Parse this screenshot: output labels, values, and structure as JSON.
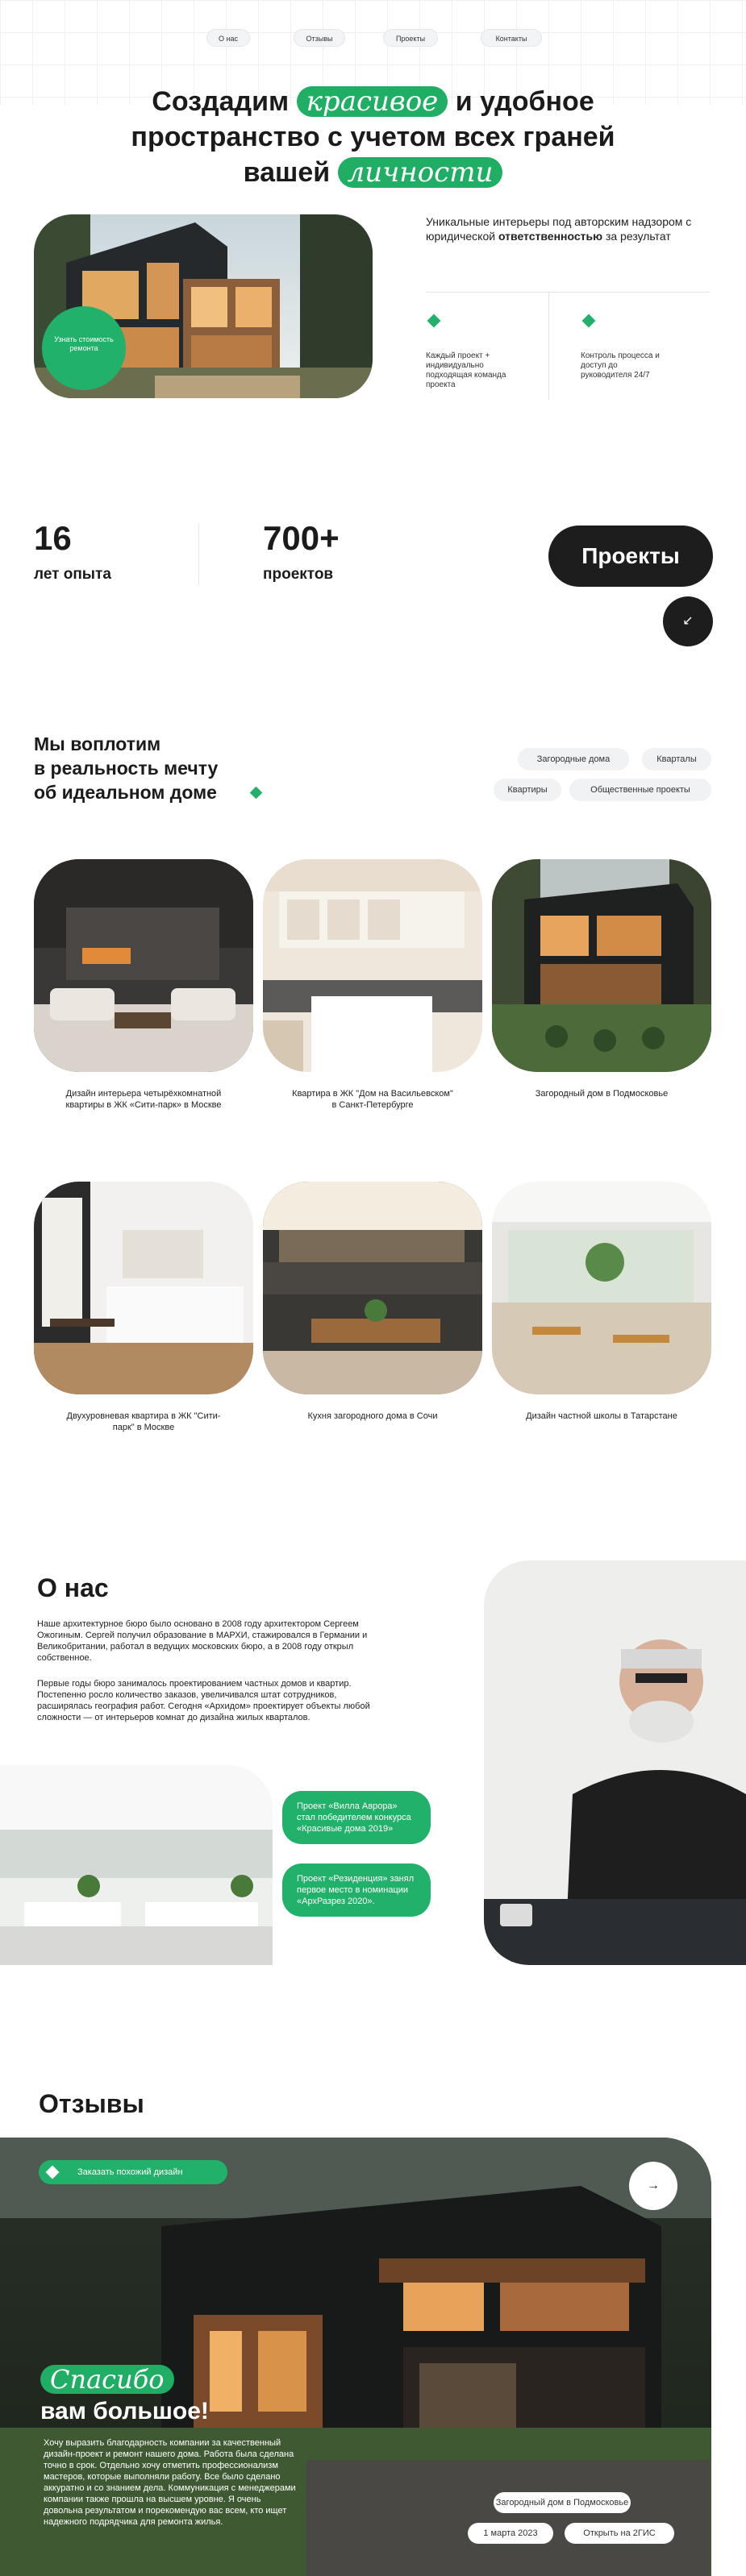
{
  "nav": {
    "items": [
      "О нас",
      "Отзывы",
      "Проекты",
      "Контакты"
    ]
  },
  "hero": {
    "line1_a": "Создадим",
    "line1_hl": "красивое",
    "line1_b": "и удобное",
    "line2": "пространство с учетом всех граней",
    "line3_a": "вашей",
    "line3_hl": "личности",
    "cta_badge": "Узнать стоимость ремонта",
    "tagline_a": "Уникальные интерьеры под авторским надзором с юридической",
    "tagline_bold": "ответственностью",
    "tagline_b": "за результат",
    "feature1": "Каждый проект + индивидуально подходящая команда проекта",
    "feature2": "Контроль процесса и доступ до руководителя 24/7"
  },
  "stats": {
    "years_num": "16",
    "years_label": "лет опыта",
    "projects_num": "700+",
    "projects_label": "проектов",
    "projects_button": "Проекты",
    "arrow": "↙"
  },
  "portfolio": {
    "title_l1": "Мы воплотим",
    "title_l2": "в реальность мечту",
    "title_l3": "об идеальном доме",
    "filters": [
      "Загородные дома",
      "Кварталы",
      "Квартиры",
      "Общественные проекты"
    ],
    "cards": [
      "Дизайн интерьера четырёхкомнатной квартиры в ЖК «Сити-парк» в Москве",
      "Квартира в ЖК \"Дом на Васильевском\" в Санкт-Петербурге",
      "Загородный дом в Подмосковье",
      "Двухуровневая квартира в ЖК \"Сити-парк\" в Москве",
      "Кухня загородного дома в Сочи",
      "Дизайн частной школы в Татарстане"
    ]
  },
  "about": {
    "title": "О нас",
    "p1": "Наше архитектурное бюро было основано в 2008 году архитектором Сергеем Ожогиным. Сергей получил образование в МАРХИ, стажировался в Германии и Великобритании, работал в ведущих московских бюро, а в 2008 году открыл собственное.",
    "p2": "Первые годы бюро занималось проектированием частных домов и квартир. Постепенно росло количество заказов, увеличивался штат сотрудников, расширялась география работ. Сегодня «Архидом» проектирует объекты любой сложности — от интерьеров комнат до дизайна жилых кварталов.",
    "award1": "Проект «Вилла Аврора» стал победителем конкурса «Красивые дома 2019»",
    "award2": "Проект «Резиденция» занял первое место в номинации «АрхРазрез 2020»."
  },
  "reviews": {
    "title": "Отзывы",
    "order_btn": "Заказать похожий дизайн",
    "thanks_hl": "Спасибо",
    "thanks_rest": "вам большое!",
    "text": "Хочу выразить благодарность компании за качественный дизайн-проект и ремонт нашего дома. Работа была сделана точно в срок. Отдельно хочу отметить профессионализм мастеров, которые выполняли работу. Все было сделано аккуратно и со знанием дела. Коммуникация с менеджерами компании также прошла на высшем уровне. Я очень довольна результатом и порекомендую вас всем, кто ищет надежного подрядчика для ремонта жилья.",
    "project_tag": "Загородный дом в Подмосковье",
    "date": "1 марта 2023",
    "source": "Открыть на 2ГИС",
    "next": "→"
  },
  "colors": {
    "accent": "#22b16a",
    "dark": "#1b1b1b"
  }
}
